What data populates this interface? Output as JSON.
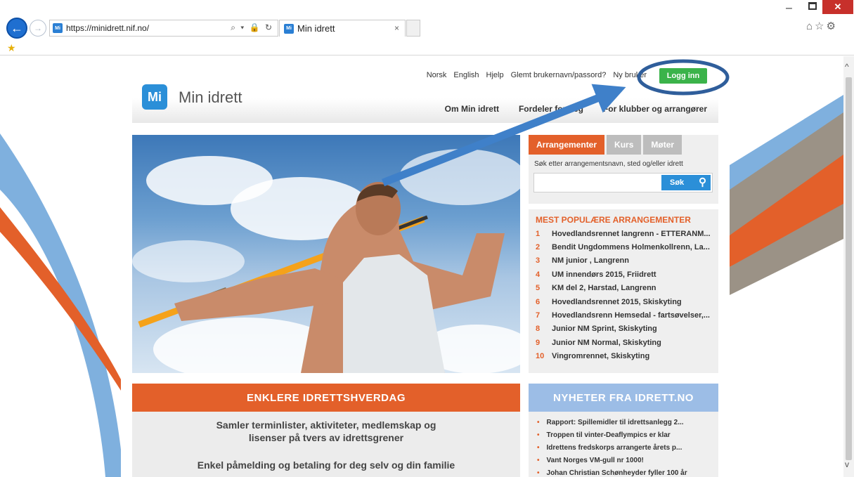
{
  "browser": {
    "url": "https://minidrett.nif.no/",
    "tab_title": "Min idrett",
    "favicon_text": "Mi",
    "close_glyph": "×",
    "tools": "⌕ ▾ 🔒 ↻"
  },
  "header": {
    "toplinks": [
      "Norsk",
      "English",
      "Hjelp",
      "Glemt brukernavn/passord?",
      "Ny bruker"
    ],
    "login_label": "Logg inn",
    "logo_mark": "Mi",
    "logo_text": "Min idrett",
    "nav": [
      "Om Min idrett",
      "Fordeler for deg",
      "For klubber og arrangører"
    ]
  },
  "search_panel": {
    "tabs": [
      "Arrangementer",
      "Kurs",
      "Møter"
    ],
    "label": "Søk etter arrangementsnavn, sted og/eller idrett",
    "button_label": "Søk"
  },
  "popular": {
    "title": "MEST POPULÆRE ARRANGEMENTER",
    "items": [
      {
        "num": "1",
        "text": "Hovedlandsrennet langrenn - ETTERANM..."
      },
      {
        "num": "2",
        "text": "Bendit Ungdommens Holmenkollrenn, La..."
      },
      {
        "num": "3",
        "text": "NM junior , Langrenn"
      },
      {
        "num": "4",
        "text": "UM innendørs 2015, Friidrett"
      },
      {
        "num": "5",
        "text": "KM del 2, Harstad, Langrenn"
      },
      {
        "num": "6",
        "text": "Hovedlandsrennet 2015, Skiskyting"
      },
      {
        "num": "7",
        "text": "Hovedlandsrenn Hemsedal - fartsøvelser,..."
      },
      {
        "num": "8",
        "text": "Junior NM Sprint, Skiskyting"
      },
      {
        "num": "9",
        "text": "Junior NM Normal, Skiskyting"
      },
      {
        "num": "10",
        "text": "Vingromrennet, Skiskyting"
      }
    ]
  },
  "enklere": {
    "title": "ENKLERE IDRETTSHVERDAG",
    "line1": "Samler terminlister, aktiviteter, medlemskap og",
    "line2": "lisenser på tvers av idrettsgrener",
    "line3": "Enkel påmelding og betaling for deg selv og din familie"
  },
  "news": {
    "title": "NYHETER FRA IDRETT.NO",
    "items": [
      "Rapport: Spillemidler til idrettsanlegg 2...",
      "Troppen til vinter-Deaflympics er klar",
      "Idrettens fredskorps arrangerte årets p...",
      "Vant Norges VM-gull nr 1000!",
      "Johan Christian Schønheyder fyller 100 år"
    ]
  },
  "colors": {
    "accent_orange": "#e3602a",
    "brand_blue": "#2b8fd8",
    "login_green": "#3bb34a",
    "annotation_blue": "#2f6fb5"
  }
}
